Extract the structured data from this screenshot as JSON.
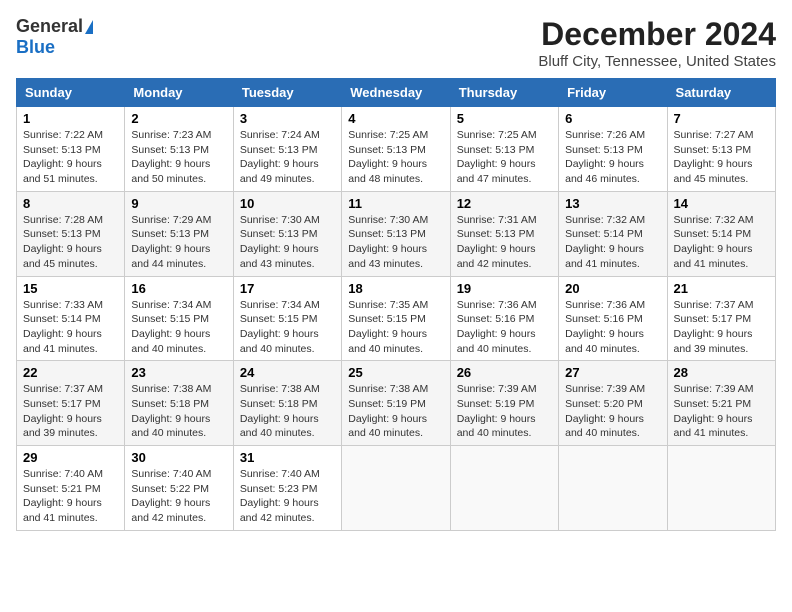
{
  "logo": {
    "general": "General",
    "blue": "Blue"
  },
  "title": "December 2024",
  "location": "Bluff City, Tennessee, United States",
  "days_of_week": [
    "Sunday",
    "Monday",
    "Tuesday",
    "Wednesday",
    "Thursday",
    "Friday",
    "Saturday"
  ],
  "weeks": [
    [
      {
        "day": "1",
        "sunrise": "Sunrise: 7:22 AM",
        "sunset": "Sunset: 5:13 PM",
        "daylight": "Daylight: 9 hours and 51 minutes."
      },
      {
        "day": "2",
        "sunrise": "Sunrise: 7:23 AM",
        "sunset": "Sunset: 5:13 PM",
        "daylight": "Daylight: 9 hours and 50 minutes."
      },
      {
        "day": "3",
        "sunrise": "Sunrise: 7:24 AM",
        "sunset": "Sunset: 5:13 PM",
        "daylight": "Daylight: 9 hours and 49 minutes."
      },
      {
        "day": "4",
        "sunrise": "Sunrise: 7:25 AM",
        "sunset": "Sunset: 5:13 PM",
        "daylight": "Daylight: 9 hours and 48 minutes."
      },
      {
        "day": "5",
        "sunrise": "Sunrise: 7:25 AM",
        "sunset": "Sunset: 5:13 PM",
        "daylight": "Daylight: 9 hours and 47 minutes."
      },
      {
        "day": "6",
        "sunrise": "Sunrise: 7:26 AM",
        "sunset": "Sunset: 5:13 PM",
        "daylight": "Daylight: 9 hours and 46 minutes."
      },
      {
        "day": "7",
        "sunrise": "Sunrise: 7:27 AM",
        "sunset": "Sunset: 5:13 PM",
        "daylight": "Daylight: 9 hours and 45 minutes."
      }
    ],
    [
      {
        "day": "8",
        "sunrise": "Sunrise: 7:28 AM",
        "sunset": "Sunset: 5:13 PM",
        "daylight": "Daylight: 9 hours and 45 minutes."
      },
      {
        "day": "9",
        "sunrise": "Sunrise: 7:29 AM",
        "sunset": "Sunset: 5:13 PM",
        "daylight": "Daylight: 9 hours and 44 minutes."
      },
      {
        "day": "10",
        "sunrise": "Sunrise: 7:30 AM",
        "sunset": "Sunset: 5:13 PM",
        "daylight": "Daylight: 9 hours and 43 minutes."
      },
      {
        "day": "11",
        "sunrise": "Sunrise: 7:30 AM",
        "sunset": "Sunset: 5:13 PM",
        "daylight": "Daylight: 9 hours and 43 minutes."
      },
      {
        "day": "12",
        "sunrise": "Sunrise: 7:31 AM",
        "sunset": "Sunset: 5:13 PM",
        "daylight": "Daylight: 9 hours and 42 minutes."
      },
      {
        "day": "13",
        "sunrise": "Sunrise: 7:32 AM",
        "sunset": "Sunset: 5:14 PM",
        "daylight": "Daylight: 9 hours and 41 minutes."
      },
      {
        "day": "14",
        "sunrise": "Sunrise: 7:32 AM",
        "sunset": "Sunset: 5:14 PM",
        "daylight": "Daylight: 9 hours and 41 minutes."
      }
    ],
    [
      {
        "day": "15",
        "sunrise": "Sunrise: 7:33 AM",
        "sunset": "Sunset: 5:14 PM",
        "daylight": "Daylight: 9 hours and 41 minutes."
      },
      {
        "day": "16",
        "sunrise": "Sunrise: 7:34 AM",
        "sunset": "Sunset: 5:15 PM",
        "daylight": "Daylight: 9 hours and 40 minutes."
      },
      {
        "day": "17",
        "sunrise": "Sunrise: 7:34 AM",
        "sunset": "Sunset: 5:15 PM",
        "daylight": "Daylight: 9 hours and 40 minutes."
      },
      {
        "day": "18",
        "sunrise": "Sunrise: 7:35 AM",
        "sunset": "Sunset: 5:15 PM",
        "daylight": "Daylight: 9 hours and 40 minutes."
      },
      {
        "day": "19",
        "sunrise": "Sunrise: 7:36 AM",
        "sunset": "Sunset: 5:16 PM",
        "daylight": "Daylight: 9 hours and 40 minutes."
      },
      {
        "day": "20",
        "sunrise": "Sunrise: 7:36 AM",
        "sunset": "Sunset: 5:16 PM",
        "daylight": "Daylight: 9 hours and 40 minutes."
      },
      {
        "day": "21",
        "sunrise": "Sunrise: 7:37 AM",
        "sunset": "Sunset: 5:17 PM",
        "daylight": "Daylight: 9 hours and 39 minutes."
      }
    ],
    [
      {
        "day": "22",
        "sunrise": "Sunrise: 7:37 AM",
        "sunset": "Sunset: 5:17 PM",
        "daylight": "Daylight: 9 hours and 39 minutes."
      },
      {
        "day": "23",
        "sunrise": "Sunrise: 7:38 AM",
        "sunset": "Sunset: 5:18 PM",
        "daylight": "Daylight: 9 hours and 40 minutes."
      },
      {
        "day": "24",
        "sunrise": "Sunrise: 7:38 AM",
        "sunset": "Sunset: 5:18 PM",
        "daylight": "Daylight: 9 hours and 40 minutes."
      },
      {
        "day": "25",
        "sunrise": "Sunrise: 7:38 AM",
        "sunset": "Sunset: 5:19 PM",
        "daylight": "Daylight: 9 hours and 40 minutes."
      },
      {
        "day": "26",
        "sunrise": "Sunrise: 7:39 AM",
        "sunset": "Sunset: 5:19 PM",
        "daylight": "Daylight: 9 hours and 40 minutes."
      },
      {
        "day": "27",
        "sunrise": "Sunrise: 7:39 AM",
        "sunset": "Sunset: 5:20 PM",
        "daylight": "Daylight: 9 hours and 40 minutes."
      },
      {
        "day": "28",
        "sunrise": "Sunrise: 7:39 AM",
        "sunset": "Sunset: 5:21 PM",
        "daylight": "Daylight: 9 hours and 41 minutes."
      }
    ],
    [
      {
        "day": "29",
        "sunrise": "Sunrise: 7:40 AM",
        "sunset": "Sunset: 5:21 PM",
        "daylight": "Daylight: 9 hours and 41 minutes."
      },
      {
        "day": "30",
        "sunrise": "Sunrise: 7:40 AM",
        "sunset": "Sunset: 5:22 PM",
        "daylight": "Daylight: 9 hours and 42 minutes."
      },
      {
        "day": "31",
        "sunrise": "Sunrise: 7:40 AM",
        "sunset": "Sunset: 5:23 PM",
        "daylight": "Daylight: 9 hours and 42 minutes."
      },
      null,
      null,
      null,
      null
    ]
  ]
}
